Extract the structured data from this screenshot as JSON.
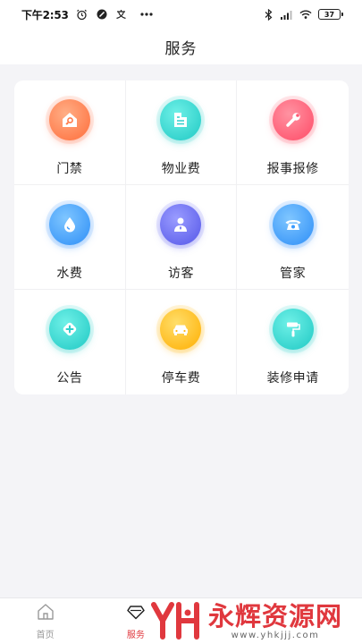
{
  "status_bar": {
    "time": "下午2:53",
    "extra_icons": [
      "alarm-icon",
      "do-not-disturb-icon",
      "input-method-icon",
      "more-icon"
    ],
    "battery": "37"
  },
  "header": {
    "title": "服务"
  },
  "services": [
    {
      "label": "门禁",
      "icon": "key-house-icon",
      "color": "#ff8a5b"
    },
    {
      "label": "物业费",
      "icon": "bill-icon",
      "color": "#33d4d0"
    },
    {
      "label": "报事报修",
      "icon": "wrench-icon",
      "color": "#ff6a80"
    },
    {
      "label": "水费",
      "icon": "water-drop-icon",
      "color": "#3ea3ff"
    },
    {
      "label": "访客",
      "icon": "visitor-icon",
      "color": "#6a6cf5"
    },
    {
      "label": "管家",
      "icon": "telephone-icon",
      "color": "#3ea3ff"
    },
    {
      "label": "公告",
      "icon": "announcement-icon",
      "color": "#33d4d0"
    },
    {
      "label": "停车费",
      "icon": "car-icon",
      "color": "#ffc41a"
    },
    {
      "label": "装修申请",
      "icon": "paint-roller-icon",
      "color": "#33d4d0"
    }
  ],
  "tab_bar": {
    "tabs": [
      {
        "label": "首页",
        "icon": "home-icon"
      },
      {
        "label": "服务",
        "icon": "diamond-icon",
        "active": true
      },
      {
        "label": "",
        "icon": ""
      },
      {
        "label": "",
        "icon": ""
      }
    ]
  },
  "watermark": {
    "title": "永辉资源网",
    "url": "www.yhkjjj.com"
  }
}
